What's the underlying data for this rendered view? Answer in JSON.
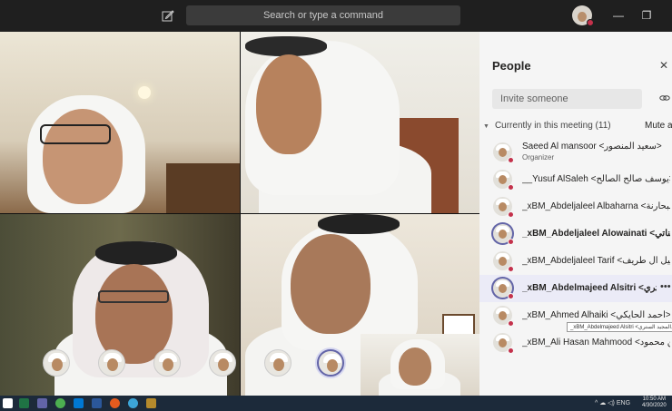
{
  "titlebar": {
    "search_placeholder": "Search or type a command",
    "minimize": "—",
    "restore": "❐"
  },
  "people_panel": {
    "title": "People",
    "close_icon": "close-icon",
    "invite_placeholder": "Invite someone",
    "section_label": "Currently in this meeting (11)",
    "mute_all": "Mute al",
    "participants": [
      {
        "name": "Saeed Al mansoor <سعيد المنصور>",
        "role": "Organizer",
        "bold": false
      },
      {
        "name": "__Yusuf AlSaleh <يوسف صالح الصالح>",
        "role": "",
        "bold": false
      },
      {
        "name": "_xBM_Abdeljaleel Albaharna <عبدالجليل البحارنة>",
        "role": "",
        "bold": false
      },
      {
        "name": "_xBM_Abdeljaleel Alowainati <عبدالجليل العويناتي>",
        "role": "",
        "bold": true
      },
      {
        "name": "_xBM_Abdeljaleel Tarif <عبدالجليل آل طريف>",
        "role": "",
        "bold": false
      },
      {
        "name": "_xBM_Abdelmajeed Alsitri <عبدالمجيد الستري>",
        "role": "",
        "bold": true
      },
      {
        "name": "_xBM_Ahmed Alhaiki <أحمد الحايكي>",
        "role": "",
        "bold": false
      },
      {
        "name": "_xBM_Ali Hasan Mahmood <علي حسن محمود>",
        "role": "",
        "bold": false
      }
    ],
    "tooltip": "_xBM_Abdelmajeed Alsitri <عبدالمجيد الستري>"
  },
  "taskbar": {
    "lang": "ENG",
    "time": "10:50 AM",
    "date": "4/30/2020"
  },
  "colors": {
    "accent": "#6264a7",
    "busy": "#c4314b"
  }
}
